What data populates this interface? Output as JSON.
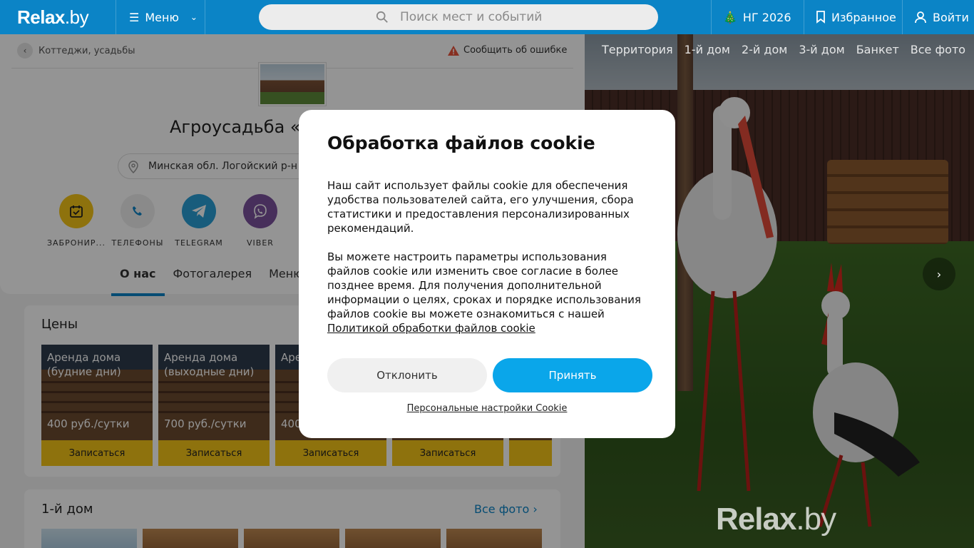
{
  "header": {
    "logo": "Relax",
    "logo_suffix": ".by",
    "menu_label": "Меню",
    "search_placeholder": "Поиск мест и событий",
    "ny_label": "НГ 2026",
    "favorites_label": "Избранное",
    "login_label": "Войти"
  },
  "breadcrumb": {
    "label": "Коттеджи, усадьбы"
  },
  "report_error_label": "Сообщить об ошибке",
  "place": {
    "title": "Агроусадьба «",
    "address": "Минская обл. Логойский р-н"
  },
  "actions": [
    {
      "label": "ЗАБРОНИР...",
      "icon": "calendar-icon"
    },
    {
      "label": "ТЕЛЕФОНЫ",
      "icon": "phone-icon"
    },
    {
      "label": "TELEGRAM",
      "icon": "telegram-icon"
    },
    {
      "label": "VIBER",
      "icon": "viber-icon"
    }
  ],
  "tabs": [
    "О нас",
    "Фотогалерея",
    "Меню"
  ],
  "prices": {
    "title": "Цены",
    "items": [
      {
        "title": "Аренда дома (будние дни)",
        "price": "400 руб./сутки",
        "button": "Записаться"
      },
      {
        "title": "Аренда дома (выходные дни)",
        "price": "700 руб./сутки",
        "button": "Записаться"
      },
      {
        "title": "Аре (бу",
        "price": "400",
        "button": "Записаться"
      },
      {
        "title": "",
        "price": "",
        "button": "Записаться"
      }
    ]
  },
  "house1": {
    "title": "1-й дом",
    "all_photos": "Все фото"
  },
  "photo_tabs": [
    "Территория",
    "1-й дом",
    "2-й дом",
    "3-й дом",
    "Банкет",
    "Все фото"
  ],
  "watermark": {
    "text": "Relax",
    "suffix": ".by"
  },
  "cookie_modal": {
    "title": "Обработка файлов cookie",
    "paragraph1": "Наш сайт использует файлы cookie для обеспечения удобства пользователей сайта, его улучшения, сбора статистики и предоставления персонализированных рекомендаций.",
    "paragraph2": "Вы можете настроить параметры использования файлов cookie или изменить свое согласие в более позднее время. Для получения дополнительной информации о целях, сроках и порядке использования файлов cookie вы можете ознакомиться с нашей",
    "policy_link": "Политикой обработки файлов cookie",
    "decline": "Отклонить",
    "accept": "Принять",
    "personal_settings": "Персональные настройки Cookie"
  },
  "colors": {
    "brand": "#0b84c6",
    "accept": "#0aa6ea",
    "cta_yellow": "#f5c518",
    "telegram": "#2a9fd6",
    "viber": "#7b519d"
  }
}
